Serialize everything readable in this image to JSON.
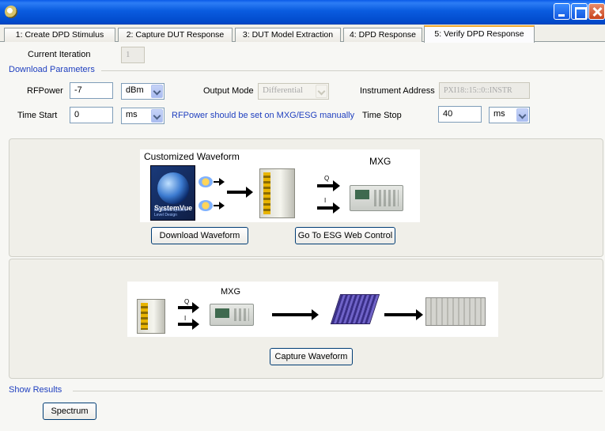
{
  "window": {
    "title": ""
  },
  "tabs": [
    {
      "label": "1: Create DPD Stimulus"
    },
    {
      "label": "2: Capture DUT Response"
    },
    {
      "label": "3: DUT Model Extraction"
    },
    {
      "label": "4: DPD Response"
    },
    {
      "label": "5: Verify DPD Response"
    }
  ],
  "active_tab": "5: Verify DPD Response",
  "iteration": {
    "label": "Current Iteration",
    "value": "1"
  },
  "download": {
    "group_title": "Download Parameters",
    "rfpower_label": "RFPower",
    "rfpower_value": "-7",
    "rfpower_unit": "dBm",
    "output_mode_label": "Output Mode",
    "output_mode_value": "Differential",
    "instrument_label": "Instrument Address",
    "instrument_value": "PXI18::15::0::INSTR",
    "time_start_label": "Time Start",
    "time_start_value": "0",
    "time_start_unit": "ms",
    "note": "RFPower should be set on MXG/ESG manually",
    "time_stop_label": "Time Stop",
    "time_stop_value": "40",
    "time_stop_unit": "ms"
  },
  "diagram1": {
    "title": "Customized Waveform",
    "instrument": "MXG",
    "brand": "SystemVue",
    "brand_sub": "Electronic System-Level Design",
    "i_label": "I",
    "q_label": "Q"
  },
  "buttons": {
    "download_waveform": "Download Waveform",
    "esg_web_control": "Go To ESG Web Control",
    "capture_waveform": "Capture Waveform",
    "spectrum": "Spectrum"
  },
  "diagram2": {
    "instrument": "MXG",
    "i_label": "I",
    "q_label": "Q"
  },
  "results": {
    "group_title": "Show Results"
  },
  "colors": {
    "titlebar": "#0a5ae8",
    "accent_text": "#1f3fbf",
    "active_tab_border": "#f0a830"
  },
  "icons": [
    "app-icon",
    "minimize-icon",
    "maximize-icon",
    "close-icon",
    "dropdown-chevron-icon",
    "folder-icon",
    "globe-icon"
  ]
}
